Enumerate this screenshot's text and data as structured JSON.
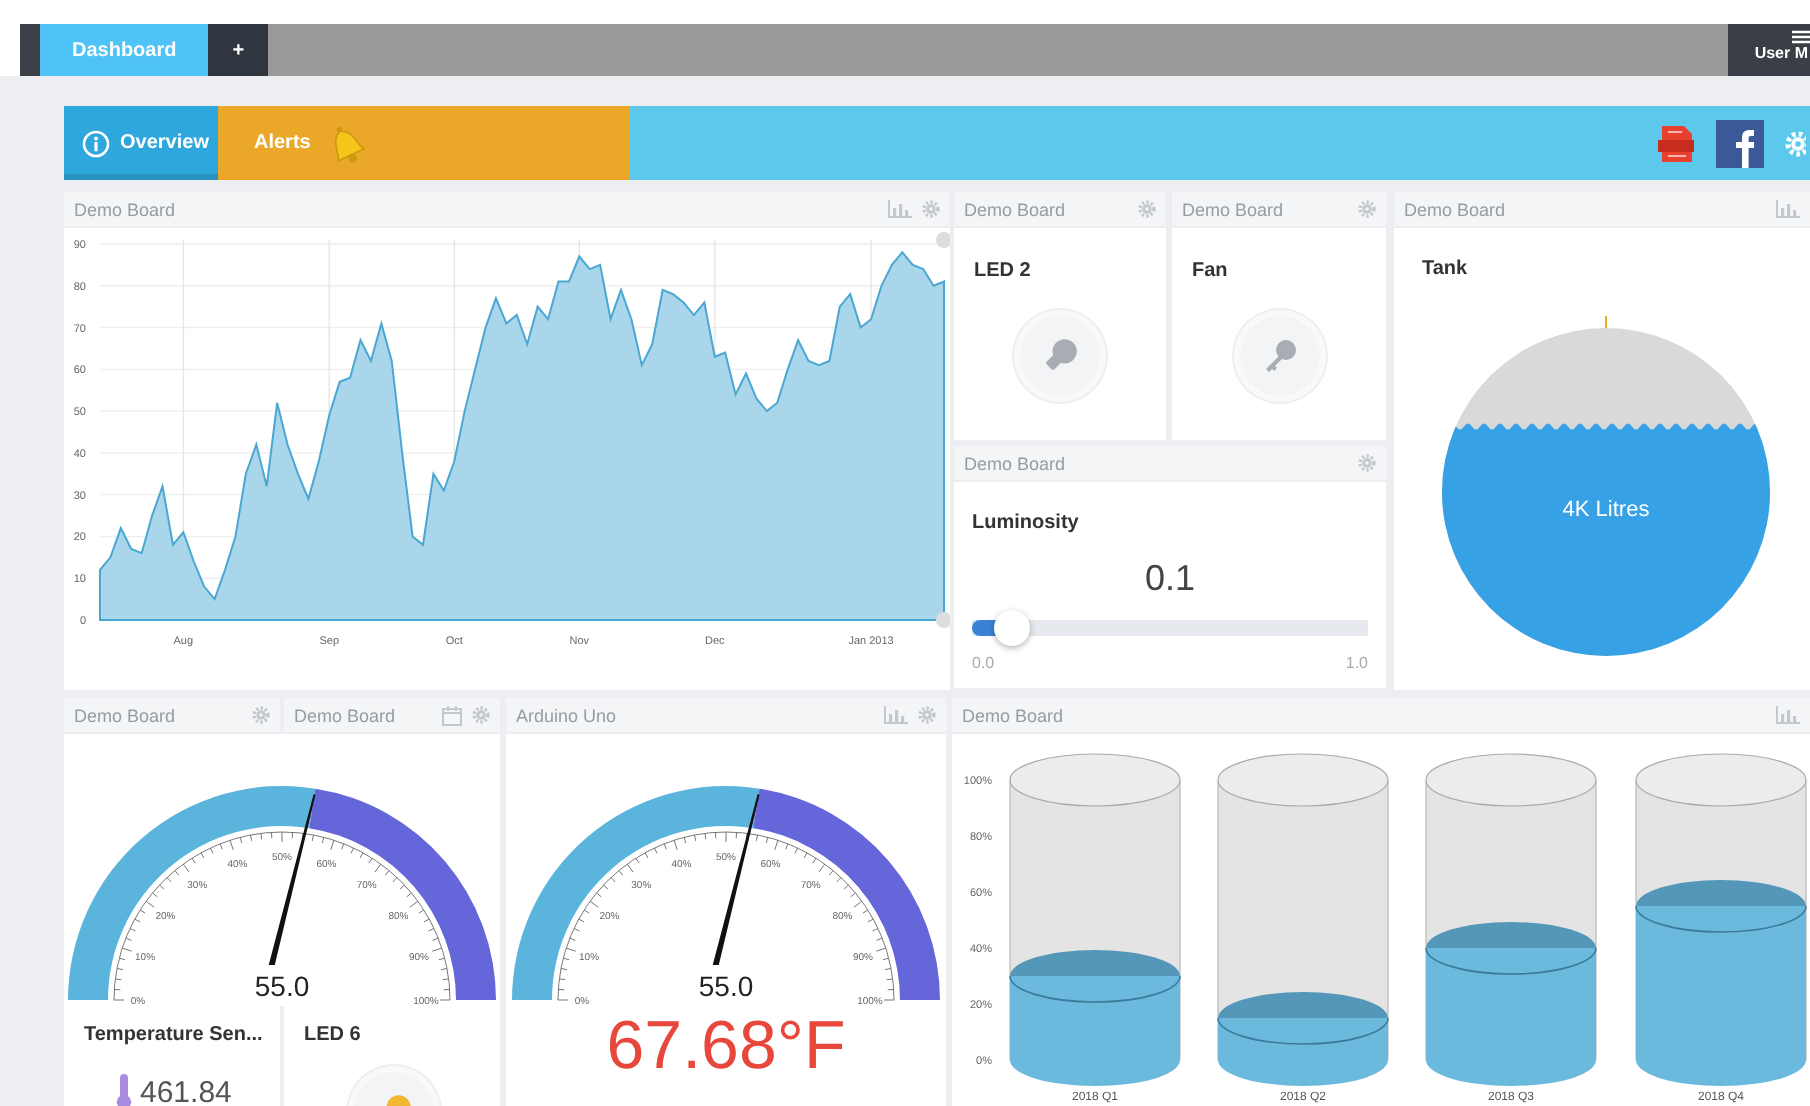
{
  "top_bar": {
    "tabs": [
      {
        "label": "Dashboard",
        "selected": true
      },
      {
        "label": "+",
        "selected": false
      }
    ],
    "user_menu": "User M"
  },
  "nav": {
    "items": [
      {
        "label": "Overview",
        "selected": true,
        "color": "#2ea8dc",
        "kind": "info"
      },
      {
        "label": "Alerts",
        "selected": false,
        "color": "#eba727",
        "kind": "bell"
      }
    ]
  },
  "history_chart": {
    "header": "Demo Board",
    "chart_data": {
      "type": "area",
      "categories": [
        null,
        null,
        null,
        null,
        null,
        null,
        null,
        null,
        "Aug",
        null,
        null,
        null,
        null,
        null,
        null,
        null,
        null,
        null,
        null,
        null,
        null,
        null,
        "Sep",
        null,
        null,
        null,
        null,
        null,
        null,
        null,
        null,
        null,
        null,
        null,
        "Oct",
        null,
        null,
        null,
        null,
        null,
        null,
        null,
        null,
        null,
        null,
        null,
        "Nov",
        null,
        null,
        null,
        null,
        null,
        null,
        null,
        null,
        null,
        null,
        null,
        null,
        "Dec",
        null,
        null,
        null,
        null,
        null,
        null,
        null,
        null,
        null,
        null,
        null,
        null,
        null,
        null,
        "Jan 2013",
        null,
        null,
        null,
        null,
        null,
        null,
        null
      ],
      "values": [
        12,
        15,
        22,
        17,
        16,
        25,
        32,
        18,
        21,
        14,
        8,
        5,
        12,
        20,
        35,
        42,
        32,
        52,
        42,
        35,
        29,
        38,
        49,
        57,
        58,
        67,
        62,
        71,
        62,
        40,
        20,
        18,
        35,
        31,
        38,
        50,
        60,
        70,
        77,
        71,
        73,
        66,
        75,
        72,
        81,
        81,
        87,
        84,
        85,
        72,
        79,
        72,
        61,
        66,
        79,
        78,
        76,
        73,
        76,
        63,
        64,
        54,
        59,
        53,
        50,
        52,
        60,
        67,
        62,
        61,
        62,
        75,
        78,
        70,
        72,
        80,
        85,
        88,
        85,
        84,
        80,
        81
      ],
      "ylim": [
        0,
        90
      ],
      "yticks": [
        0,
        10,
        20,
        30,
        40,
        50,
        60,
        70,
        80,
        90
      ],
      "grid": true
    }
  },
  "led_2": {
    "header": "Demo Board",
    "title": "LED 2",
    "on": false
  },
  "fan": {
    "header": "Demo Board",
    "title": "Fan",
    "on": false
  },
  "luminosity": {
    "header": "Demo Board",
    "title": "Luminosity",
    "reading": "0.1",
    "level": 0.1,
    "min": "0.0",
    "max": "1.0"
  },
  "tank": {
    "header": "Demo Board",
    "title": "Tank",
    "reading": "4K Litres"
  },
  "temperature": {
    "headers": [
      {
        "header": "Demo Board"
      },
      {
        "header": "Demo Board"
      }
    ],
    "gauge": {
      "reading": "55.0",
      "ticks": [
        "0%",
        "10%",
        "20%",
        "30%",
        "40%",
        "50%",
        "60%",
        "70%",
        "80%",
        "90%",
        "100%"
      ]
    },
    "sensor": {
      "title": "Temperature Sen...",
      "reading": "461.84"
    },
    "led": {
      "title": "LED 6",
      "on": true
    }
  },
  "arduino": {
    "header": "Arduino Uno",
    "gauge": {
      "reading": "55.0",
      "ticks": [
        "0%",
        "10%",
        "20%",
        "30%",
        "40%",
        "50%",
        "60%",
        "70%",
        "80%",
        "90%",
        "100%"
      ]
    },
    "reading": "67.68°F"
  },
  "quarters_chart": {
    "header": "Demo Board",
    "chart_data": {
      "type": "bar",
      "categories": [
        "2018 Q1",
        "2018 Q2",
        "2018 Q3",
        "2018 Q4"
      ],
      "values": [
        30,
        15,
        40,
        55
      ],
      "ylim": [
        0,
        100
      ],
      "yticks": [
        {
          "value": 0,
          "label": "0%"
        },
        {
          "value": 20,
          "label": "20%"
        },
        {
          "value": 40,
          "label": "40%"
        },
        {
          "value": 60,
          "label": "60%"
        },
        {
          "value": 80,
          "label": "80%"
        },
        {
          "value": 100,
          "label": "100%"
        }
      ]
    }
  }
}
